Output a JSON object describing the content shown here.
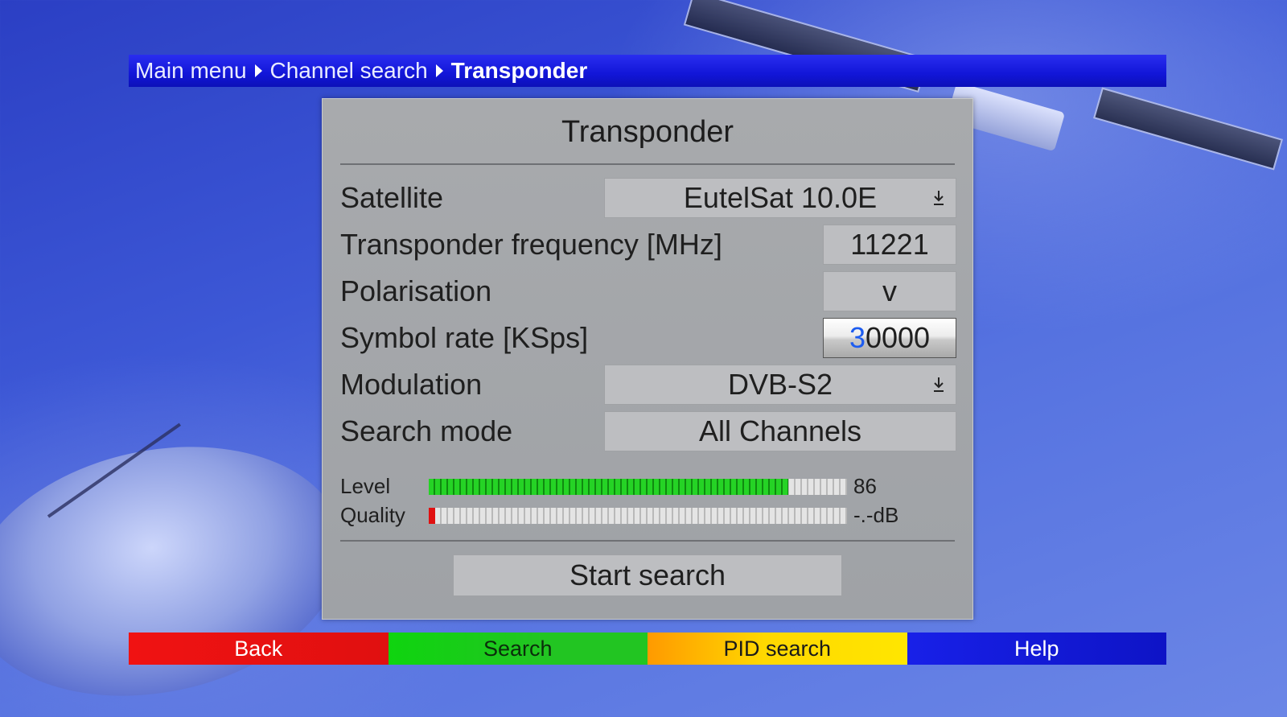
{
  "breadcrumb": {
    "items": [
      "Main menu",
      "Channel search",
      "Transponder"
    ]
  },
  "dialog": {
    "title": "Transponder",
    "rows": {
      "satellite": {
        "label": "Satellite",
        "value": "EutelSat 10.0E",
        "icon": "dropdown-arrow-icon"
      },
      "frequency": {
        "label": "Transponder frequency [MHz]",
        "value": "11221"
      },
      "polarisation": {
        "label": "Polarisation",
        "value": "v"
      },
      "symbol_rate": {
        "label": "Symbol rate [KSps]",
        "value_cursor": "3",
        "value_rest": "0000"
      },
      "modulation": {
        "label": "Modulation",
        "value": "DVB-S2",
        "icon": "dropdown-arrow-icon"
      },
      "search_mode": {
        "label": "Search mode",
        "value": "All Channels"
      }
    },
    "meters": {
      "level": {
        "label": "Level",
        "value": "86",
        "fill_fraction": 0.86
      },
      "quality": {
        "label": "Quality",
        "value": "-.-dB",
        "fill_fraction": 0.015
      }
    },
    "start_button": "Start search"
  },
  "keys": {
    "red": "Back",
    "green": "Search",
    "yellow": "PID search",
    "blue": "Help"
  },
  "colors": {
    "red_key": "#e01010",
    "green_key": "#22c522",
    "yellow_key": "#ffd800",
    "blue_key": "#1216d8",
    "cursor": "#1d5cf0",
    "level_fill": "#25d325",
    "quality_fill": "#e01010"
  }
}
